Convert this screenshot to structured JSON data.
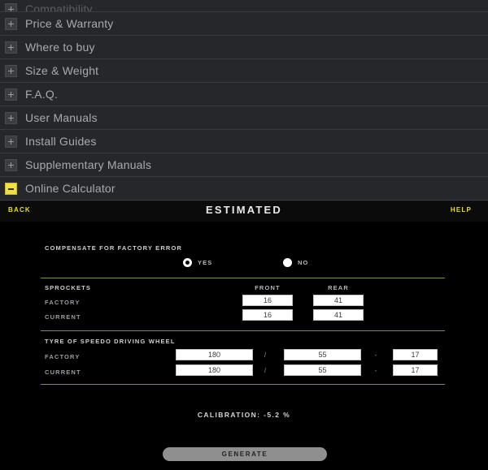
{
  "accordion": {
    "items": [
      {
        "label": "Compatibility",
        "state": "collapsed",
        "icon": "plus-icon",
        "partial": true
      },
      {
        "label": "Price & Warranty",
        "state": "collapsed",
        "icon": "plus-icon"
      },
      {
        "label": "Where to buy",
        "state": "collapsed",
        "icon": "plus-icon"
      },
      {
        "label": "Size & Weight",
        "state": "collapsed",
        "icon": "plus-icon"
      },
      {
        "label": "F.A.Q.",
        "state": "collapsed",
        "icon": "plus-icon"
      },
      {
        "label": "User Manuals",
        "state": "collapsed",
        "icon": "plus-icon"
      },
      {
        "label": "Install Guides",
        "state": "collapsed",
        "icon": "plus-icon"
      },
      {
        "label": "Supplementary Manuals",
        "state": "collapsed",
        "icon": "plus-icon"
      },
      {
        "label": "Online Calculator",
        "state": "expanded",
        "icon": "minus-icon"
      }
    ]
  },
  "calculator": {
    "header": {
      "back_label": "Back",
      "title": "Estimated",
      "help_label": "Help"
    },
    "compensate": {
      "label": "Compensate for factory error",
      "options": [
        {
          "label": "Yes",
          "selected": true
        },
        {
          "label": "No",
          "selected": false
        }
      ]
    },
    "sprockets": {
      "section_label": "Sprockets",
      "columns": [
        "Front",
        "Rear"
      ],
      "rows": [
        {
          "label": "Factory",
          "front": "16",
          "rear": "41"
        },
        {
          "label": "Current",
          "front": "16",
          "rear": "41"
        }
      ]
    },
    "tyre": {
      "section_label": "Tyre of speedo driving wheel",
      "separator_1": "/",
      "separator_2": "-",
      "rows": [
        {
          "label": "Factory",
          "width": "180",
          "aspect": "55",
          "rim": "17"
        },
        {
          "label": "Current",
          "width": "180",
          "aspect": "55",
          "rim": "17"
        }
      ]
    },
    "result": {
      "calibration_text": "Calibration: -5.2 %",
      "calibration_value": -5.2,
      "calibration_unit": "%"
    },
    "generate_label": "Generate"
  },
  "colors": {
    "accent_yellow": "#e8dd33",
    "toggle_open": "#f0e040",
    "divider": "#8e8a3c",
    "panel_bg": "#000000",
    "accordion_bg": "#26272b",
    "accordion_text": "#a9aaae"
  }
}
